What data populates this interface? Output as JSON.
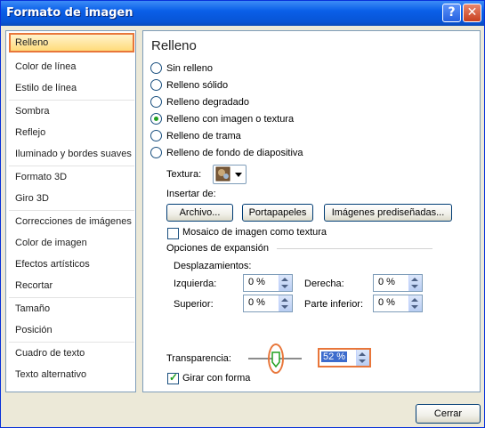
{
  "window": {
    "title": "Formato de imagen",
    "help_glyph": "?",
    "close_glyph": "✕"
  },
  "sidebar": {
    "items": [
      {
        "label": "Relleno",
        "selected": true
      },
      {
        "label": "Color de línea"
      },
      {
        "label": "Estilo de línea"
      },
      {
        "label": "Sombra"
      },
      {
        "label": "Reflejo"
      },
      {
        "label": "Iluminado y bordes suaves"
      },
      {
        "label": "Formato 3D"
      },
      {
        "label": "Giro 3D"
      },
      {
        "label": "Correcciones de imágenes"
      },
      {
        "label": "Color de imagen"
      },
      {
        "label": "Efectos artísticos"
      },
      {
        "label": "Recortar"
      },
      {
        "label": "Tamaño"
      },
      {
        "label": "Posición"
      },
      {
        "label": "Cuadro de texto"
      },
      {
        "label": "Texto alternativo"
      }
    ]
  },
  "main": {
    "heading": "Relleno",
    "fill_options": [
      {
        "label": "Sin relleno",
        "checked": false
      },
      {
        "label": "Relleno sólido",
        "checked": false
      },
      {
        "label": "Relleno degradado",
        "checked": false
      },
      {
        "label": "Relleno con imagen o textura",
        "checked": true
      },
      {
        "label": "Relleno de trama",
        "checked": false
      },
      {
        "label": "Relleno de fondo de diapositiva",
        "checked": false
      }
    ],
    "texture_label": "Textura:",
    "insert_from_label": "Insertar de:",
    "buttons": {
      "file": "Archivo...",
      "clipboard": "Portapapeles",
      "clipart": "Imágenes prediseñadas..."
    },
    "tile_checkbox": {
      "label": "Mosaico de imagen como textura",
      "checked": false
    },
    "expansion_heading": "Opciones de expansión",
    "offsets_label": "Desplazamientos:",
    "offsets": {
      "left": {
        "label": "Izquierda:",
        "value": "0 %"
      },
      "right": {
        "label": "Derecha:",
        "value": "0 %"
      },
      "top": {
        "label": "Superior:",
        "value": "0 %"
      },
      "bottom": {
        "label": "Parte inferior:",
        "value": "0 %"
      }
    },
    "transparency": {
      "label": "Transparencia:",
      "value": "52 %",
      "fraction": 0.52
    },
    "rotate_with_shape": {
      "label": "Girar con forma",
      "checked": true
    }
  },
  "footer": {
    "close_label": "Cerrar"
  },
  "colors": {
    "accent_orange": "#e8763a",
    "title_blue": "#0a5fe8",
    "selected_bg": "#ffdb7a"
  }
}
